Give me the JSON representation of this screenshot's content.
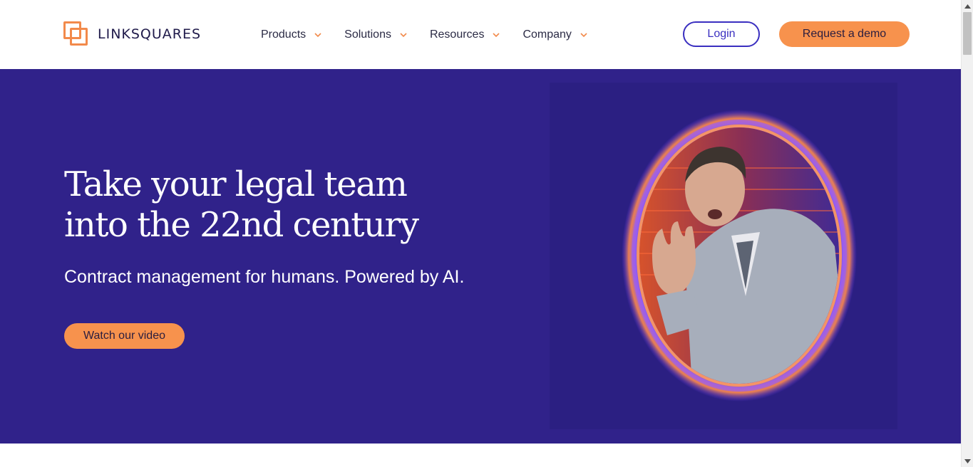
{
  "header": {
    "logo_text": "LINKSQUARES",
    "nav": [
      {
        "label": "Products"
      },
      {
        "label": "Solutions"
      },
      {
        "label": "Resources"
      },
      {
        "label": "Company"
      }
    ],
    "login_label": "Login",
    "demo_label": "Request a demo"
  },
  "hero": {
    "title_line1": "Take your legal team",
    "title_line2": "into the 22nd century",
    "subtitle": "Contract management for humans. Powered by AI.",
    "video_button_label": "Watch our video",
    "media_icon": "portal-man-waving-image"
  },
  "colors": {
    "brand_orange": "#f7924d",
    "hero_background": "#30228a",
    "login_border": "#3a2fc0",
    "logo_text": "#1f1a4a"
  }
}
